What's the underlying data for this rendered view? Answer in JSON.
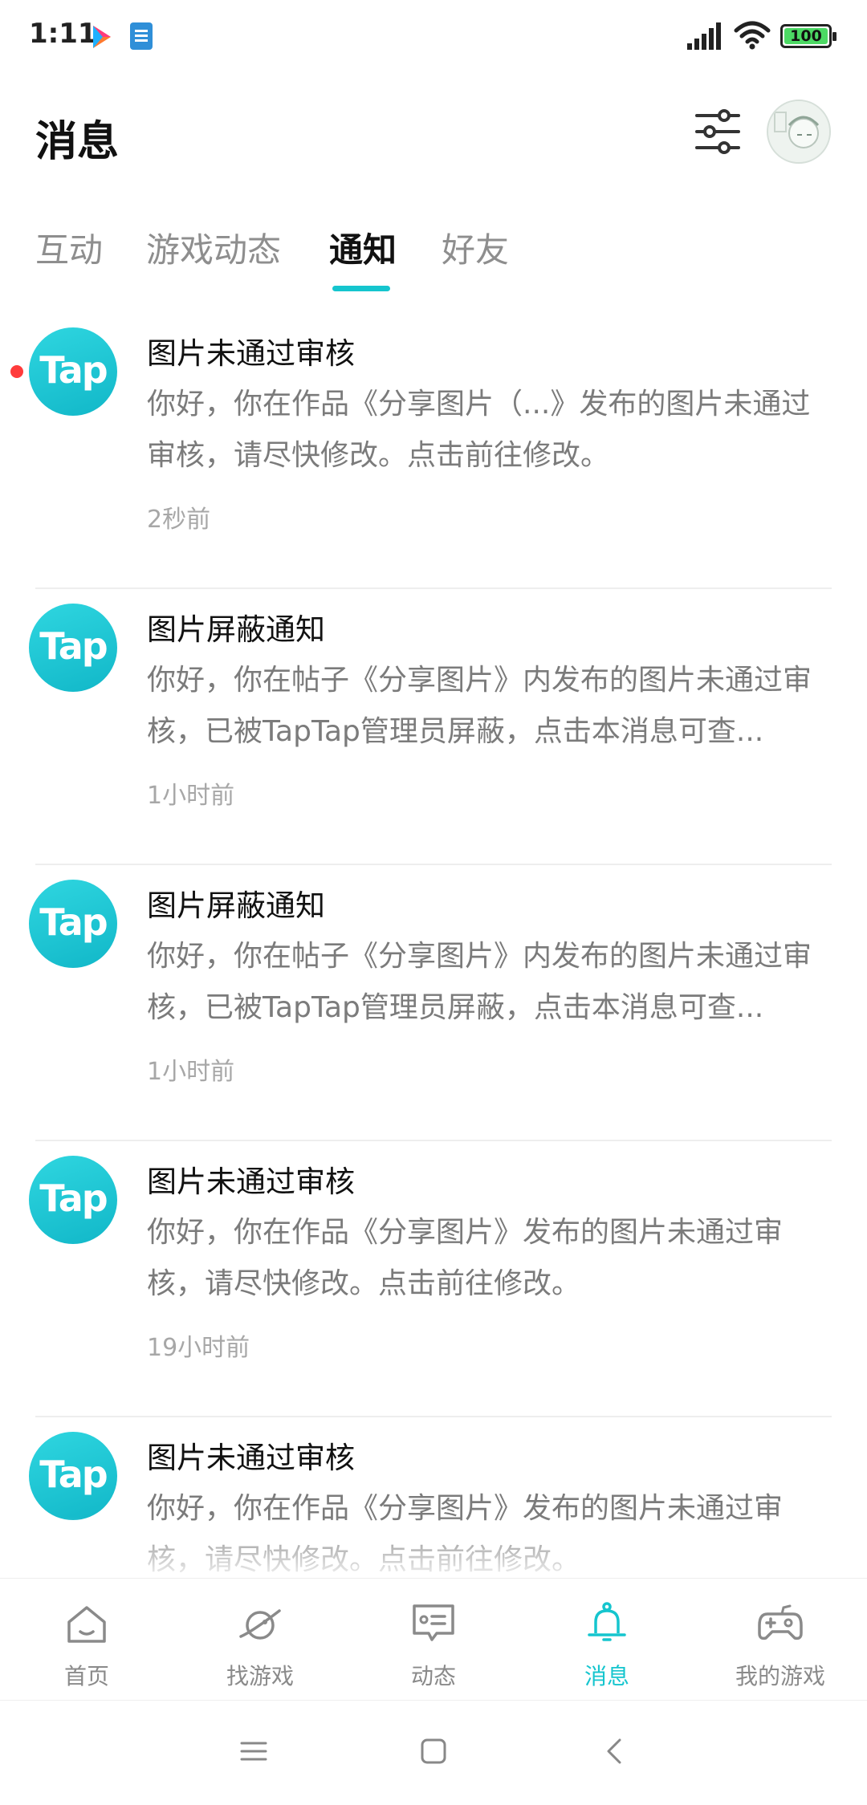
{
  "status_bar": {
    "time": "1:11",
    "battery": "100"
  },
  "header": {
    "title": "消息"
  },
  "tabs": [
    {
      "label": "互动"
    },
    {
      "label": "游戏动态"
    },
    {
      "label": "通知",
      "active": true
    },
    {
      "label": "好友"
    }
  ],
  "notifications": [
    {
      "avatar": "Tap",
      "title": "图片未通过审核",
      "body": "你好，你在作品《分享图片（...》发布的图片未通过审核，请尽快修改。点击前往修改。",
      "time": "2秒前",
      "unread": true
    },
    {
      "avatar": "Tap",
      "title": "图片屏蔽通知",
      "body": "你好，你在帖子《分享图片》内发布的图片未通过审核，已被TapTap管理员屏蔽，点击本消息可查...",
      "time": "1小时前",
      "unread": false
    },
    {
      "avatar": "Tap",
      "title": "图片屏蔽通知",
      "body": "你好，你在帖子《分享图片》内发布的图片未通过审核，已被TapTap管理员屏蔽，点击本消息可查...",
      "time": "1小时前",
      "unread": false
    },
    {
      "avatar": "Tap",
      "title": "图片未通过审核",
      "body": "你好，你在作品《分享图片》发布的图片未通过审核，请尽快修改。点击前往修改。",
      "time": "19小时前",
      "unread": false
    },
    {
      "avatar": "Tap",
      "title": "图片未通过审核",
      "body": "你好，你在作品《分享图片》发布的图片未通过审核，请尽快修改。点击前往修改。",
      "time": "",
      "unread": false
    }
  ],
  "bottom_nav": [
    {
      "label": "首页",
      "icon": "home-icon"
    },
    {
      "label": "找游戏",
      "icon": "planet-icon"
    },
    {
      "label": "动态",
      "icon": "chat-card-icon"
    },
    {
      "label": "消息",
      "icon": "bell-icon",
      "active": true
    },
    {
      "label": "我的游戏",
      "icon": "gamepad-icon"
    }
  ],
  "colors": {
    "accent": "#15c5ce",
    "unread_dot": "#ff3b3b",
    "tap_logo": "#14c0cc"
  }
}
